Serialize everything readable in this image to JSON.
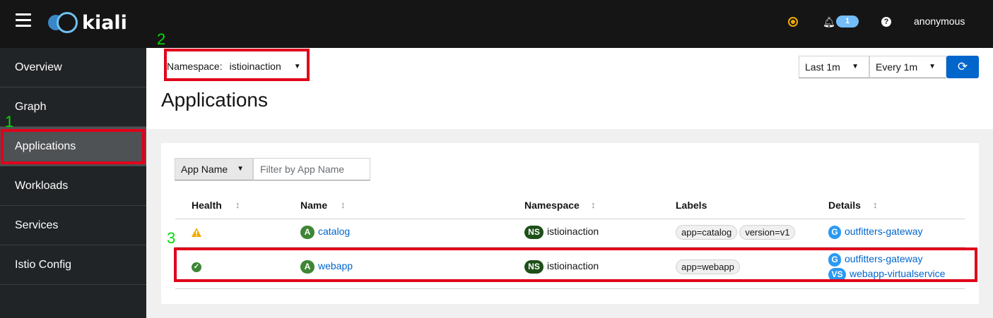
{
  "header": {
    "app_name": "kiali",
    "notification_count": "1",
    "help_glyph": "?",
    "user": "anonymous"
  },
  "sidebar": {
    "items": [
      {
        "label": "Overview"
      },
      {
        "label": "Graph"
      },
      {
        "label": "Applications"
      },
      {
        "label": "Workloads"
      },
      {
        "label": "Services"
      },
      {
        "label": "Istio Config"
      }
    ]
  },
  "toolbar": {
    "namespace_label": "Namespace:",
    "namespace_value": "istioinaction",
    "duration": "Last 1m",
    "refresh_interval": "Every 1m"
  },
  "page": {
    "title": "Applications"
  },
  "filter": {
    "type": "App Name",
    "placeholder": "Filter by App Name"
  },
  "table": {
    "columns": [
      "Health",
      "Name",
      "Namespace",
      "Labels",
      "Details"
    ],
    "rows": [
      {
        "health": "warning",
        "name_badge": "A",
        "name": "catalog",
        "ns_badge": "NS",
        "namespace": "istioinaction",
        "labels": [
          "app=catalog",
          "version=v1"
        ],
        "details": [
          {
            "badge": "G",
            "text": "outfitters-gateway"
          }
        ]
      },
      {
        "health": "healthy",
        "name_badge": "A",
        "name": "webapp",
        "ns_badge": "NS",
        "namespace": "istioinaction",
        "labels": [
          "app=webapp"
        ],
        "details": [
          {
            "badge": "G",
            "text": "outfitters-gateway"
          },
          {
            "badge": "VS",
            "text": "webapp-virtualservice"
          }
        ]
      }
    ]
  },
  "annotations": {
    "markers": [
      "1",
      "2",
      "3"
    ],
    "highlight_color": "#e0001a",
    "marker_color": "#00e000"
  }
}
